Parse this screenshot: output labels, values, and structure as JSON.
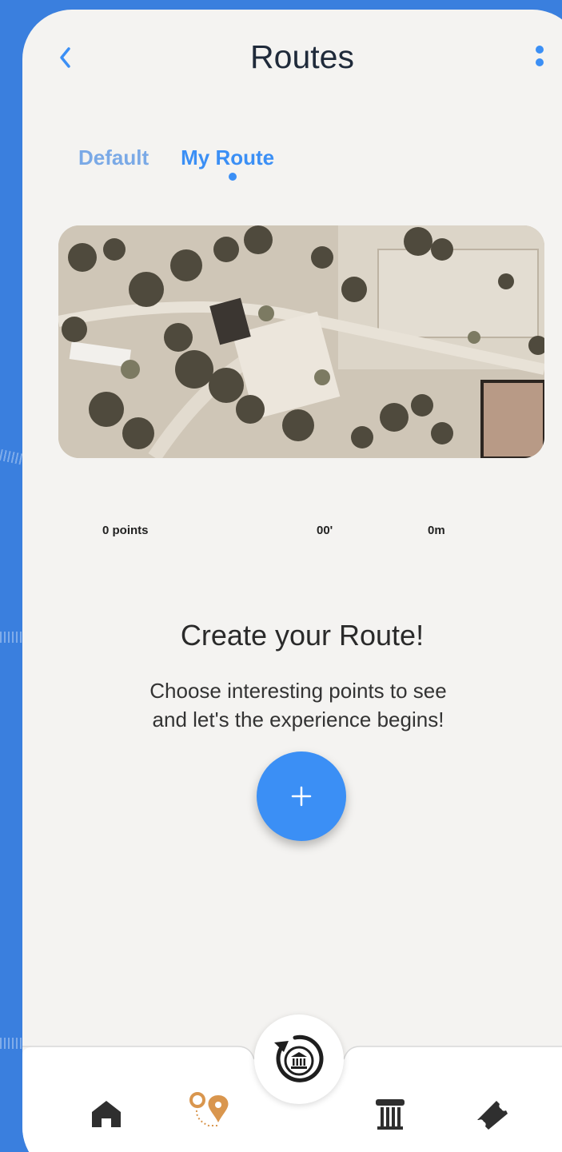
{
  "header": {
    "title": "Routes"
  },
  "tabs": [
    {
      "label": "Default"
    },
    {
      "label": "My Route"
    }
  ],
  "stats": {
    "points": "0 points",
    "time": "00'",
    "distance": "0m"
  },
  "cta": {
    "title": "Create your Route!",
    "subtitle_line1": "Choose interesting points to see",
    "subtitle_line2": "and let's the experience begins!"
  },
  "fab": {
    "icon": "plus-icon"
  },
  "nav": {
    "items": [
      "home-icon",
      "route-icon",
      "museum-history-icon",
      "column-icon",
      "ticket-icon"
    ],
    "active": "route-icon"
  },
  "colors": {
    "accent": "#3b8ff5",
    "background": "#3a7fde",
    "active_nav": "#d9964e",
    "icon_dark": "#2f2f2f"
  }
}
